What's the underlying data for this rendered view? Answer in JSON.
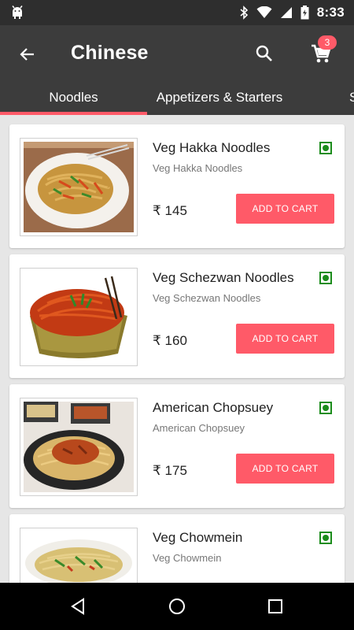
{
  "status_bar": {
    "time": "8:33"
  },
  "app_bar": {
    "title": "Chinese",
    "cart_count": "3"
  },
  "tabs": [
    {
      "label": "Noodles",
      "selected": true
    },
    {
      "label": "Appetizers & Starters",
      "selected": false
    },
    {
      "label": "S",
      "selected": false
    }
  ],
  "items": [
    {
      "name": "Veg Hakka Noodles",
      "description": "Veg Hakka Noodles",
      "price": "₹ 145",
      "button": "ADD TO CART"
    },
    {
      "name": "Veg Schezwan Noodles",
      "description": "Veg Schezwan Noodles",
      "price": "₹ 160",
      "button": "ADD TO CART"
    },
    {
      "name": "American Chopsuey",
      "description": "American Chopsuey",
      "price": "₹ 175",
      "button": "ADD TO CART"
    },
    {
      "name": "Veg Chowmein",
      "description": "Veg Chowmein",
      "price": "",
      "button": ""
    }
  ],
  "colors": {
    "accent": "#ff5a68",
    "app_bar": "#3c3c3c",
    "status_bar": "#2e2e2e",
    "veg": "#1b8c1b"
  },
  "icons": [
    "android-icon",
    "bluetooth-icon",
    "wifi-icon",
    "signal-icon",
    "battery-icon",
    "back-arrow-icon",
    "search-icon",
    "cart-icon",
    "veg-mark-icon",
    "nav-back-icon",
    "nav-home-icon",
    "nav-recents-icon"
  ]
}
